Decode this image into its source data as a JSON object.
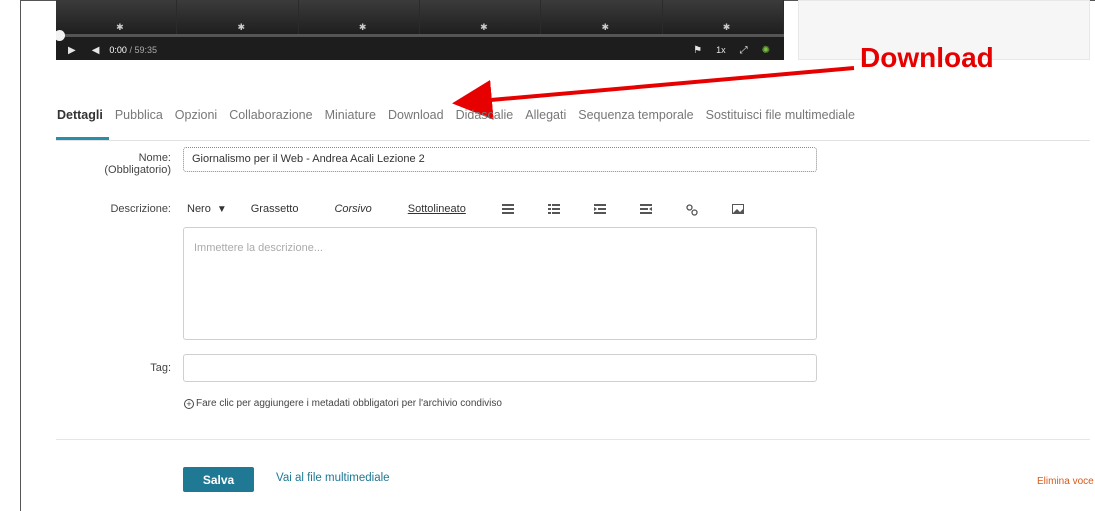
{
  "annotation": {
    "label": "Download",
    "color": "#e60000"
  },
  "player": {
    "current_time": "0:00",
    "duration": "/ 59:35",
    "speed": "1x"
  },
  "tabs": [
    {
      "label": "Dettagli",
      "active": true
    },
    {
      "label": "Pubblica"
    },
    {
      "label": "Opzioni"
    },
    {
      "label": "Collaborazione"
    },
    {
      "label": "Miniature"
    },
    {
      "label": "Download"
    },
    {
      "label": "Didascalie"
    },
    {
      "label": "Allegati"
    },
    {
      "label": "Sequenza temporale"
    },
    {
      "label": "Sostituisci file multimediale"
    }
  ],
  "form": {
    "name_label": "Nome:",
    "name_required": "(Obbligatorio)",
    "name_value": "Giornalismo per il Web - Andrea Acali Lezione 2",
    "description_label": "Descrizione:",
    "toolbar": {
      "color": "Nero",
      "bold": "Grassetto",
      "italic": "Corsivo",
      "underline": "Sottolineato"
    },
    "description_placeholder": "Immettere la descrizione...",
    "tag_label": "Tag:",
    "tag_value": "",
    "hint": "Fare clic per aggiungere i metadati obbligatori per l'archivio condiviso"
  },
  "actions": {
    "save": "Salva",
    "go_media": "Vai al file multimediale",
    "delete": "Elimina voce"
  },
  "colors": {
    "accent": "#1f7894",
    "delete": "#d65a1a"
  }
}
